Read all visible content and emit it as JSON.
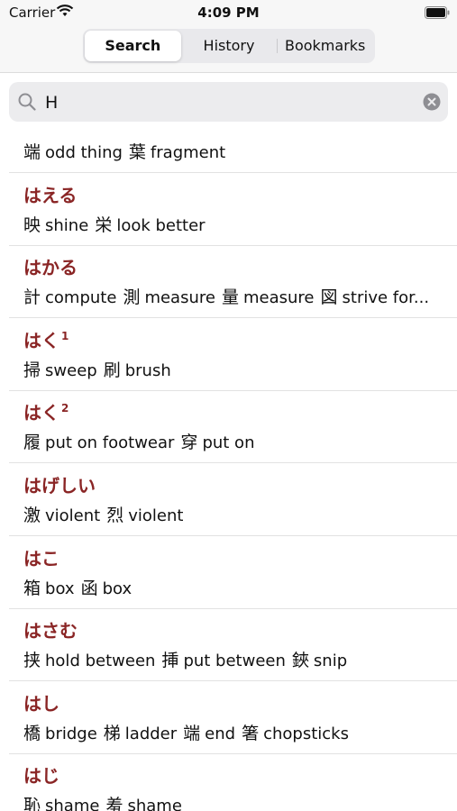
{
  "status": {
    "carrier": "Carrier",
    "time": "4:09 PM"
  },
  "tabs": [
    {
      "label": "Search",
      "active": true
    },
    {
      "label": "History",
      "active": false
    },
    {
      "label": "Bookmarks",
      "active": false
    }
  ],
  "search": {
    "value": "H"
  },
  "entries": [
    {
      "kana": "",
      "sup": "",
      "items": [
        [
          "端",
          "odd thing"
        ],
        [
          "葉",
          "fragment"
        ]
      ]
    },
    {
      "kana": "はえる",
      "sup": "",
      "items": [
        [
          "映",
          "shine"
        ],
        [
          "栄",
          "look better"
        ]
      ]
    },
    {
      "kana": "はかる",
      "sup": "",
      "items": [
        [
          "計",
          "compute"
        ],
        [
          "測",
          "measure"
        ],
        [
          "量",
          "measure"
        ],
        [
          "図",
          "strive for..."
        ]
      ]
    },
    {
      "kana": "はく",
      "sup": "1",
      "items": [
        [
          "掃",
          "sweep"
        ],
        [
          "刷",
          "brush"
        ]
      ]
    },
    {
      "kana": "はく",
      "sup": "2",
      "items": [
        [
          "履",
          "put on footwear"
        ],
        [
          "穿",
          "put on"
        ]
      ]
    },
    {
      "kana": "はげしい",
      "sup": "",
      "items": [
        [
          "激",
          "violent"
        ],
        [
          "烈",
          "violent"
        ]
      ]
    },
    {
      "kana": "はこ",
      "sup": "",
      "items": [
        [
          "箱",
          "box"
        ],
        [
          "函",
          "box"
        ]
      ]
    },
    {
      "kana": "はさむ",
      "sup": "",
      "items": [
        [
          "挟",
          "hold between"
        ],
        [
          "挿",
          "put between"
        ],
        [
          "鋏",
          "snip"
        ]
      ]
    },
    {
      "kana": "はし",
      "sup": "",
      "items": [
        [
          "橋",
          "bridge"
        ],
        [
          "梯",
          "ladder"
        ],
        [
          "端",
          "end"
        ],
        [
          "箸",
          "chopsticks"
        ]
      ]
    },
    {
      "kana": "はじ",
      "sup": "",
      "items": [
        [
          "恥",
          "shame"
        ],
        [
          "羞",
          "shame"
        ]
      ]
    }
  ]
}
